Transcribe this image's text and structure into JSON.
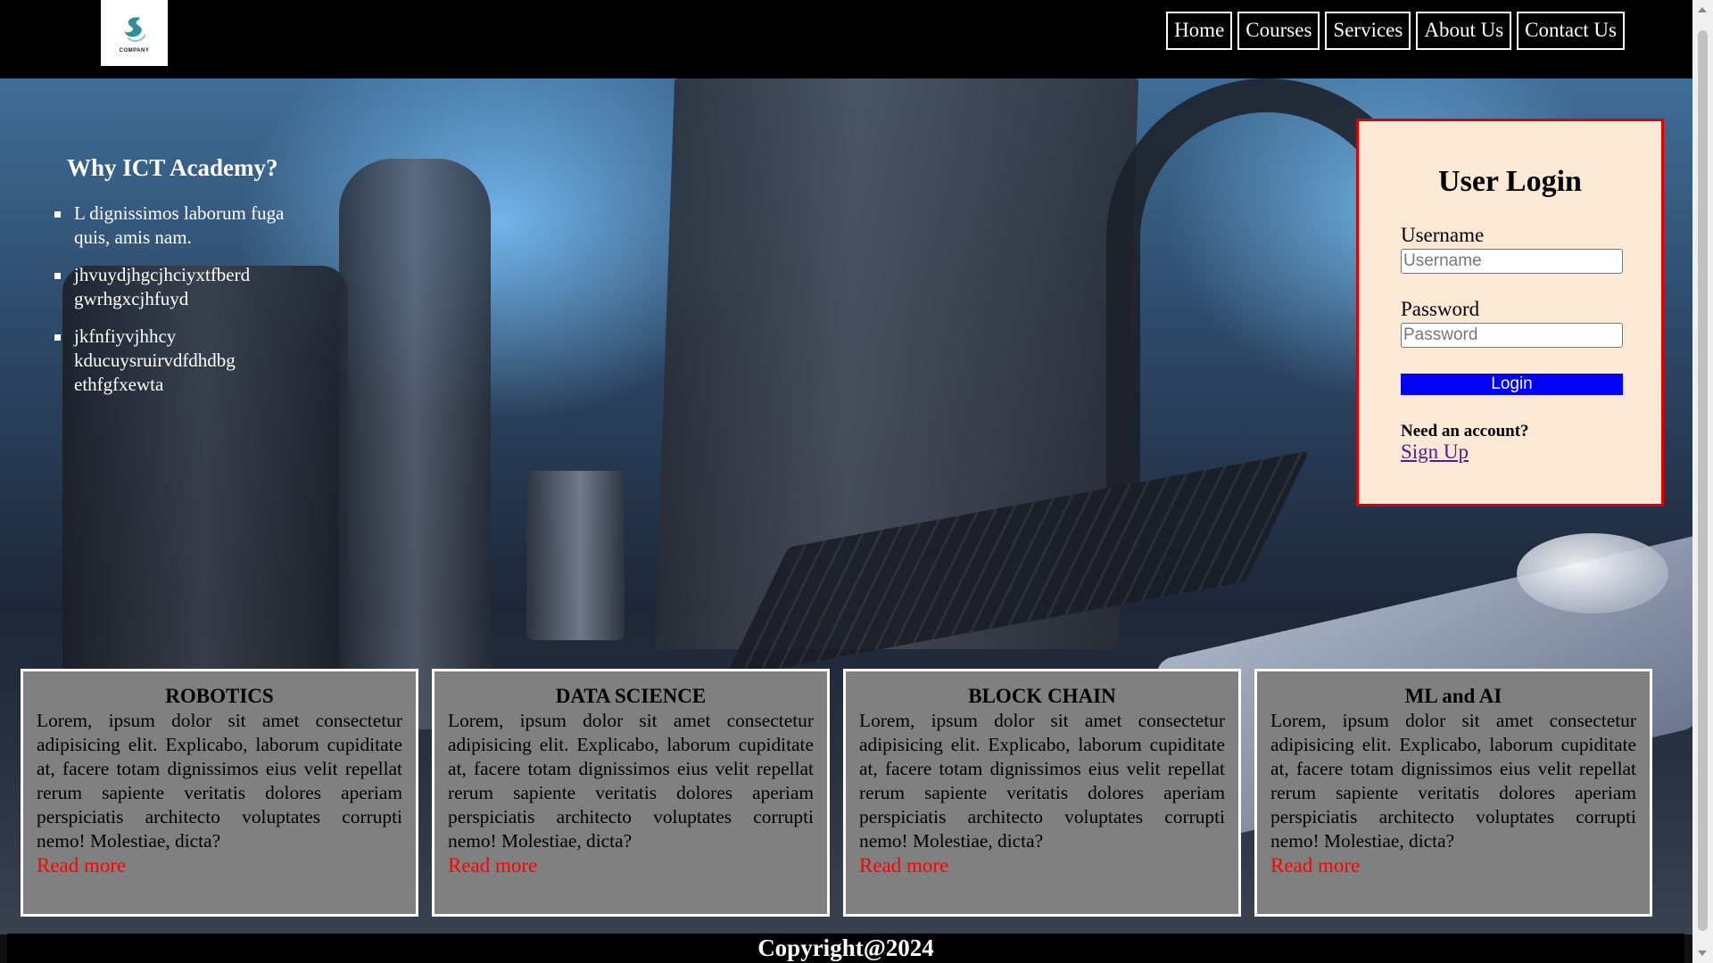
{
  "header": {
    "logo_text": "COMPANY",
    "nav": [
      "Home",
      "Courses",
      "Services",
      "About Us",
      "Contact Us"
    ]
  },
  "why": {
    "title": "Why ICT Academy?",
    "items": [
      "L dignissimos laborum fuga quis, amis nam.",
      "jhvuydjhgcjhciyxtfberd gwrhgxcjhfuyd",
      "jkfnfiyvjhhcy kducuysruirvdfdhdbg ethfgfxewta"
    ]
  },
  "login": {
    "title": "User Login",
    "username_label": "Username",
    "username_placeholder": "Username",
    "password_label": "Password",
    "password_placeholder": "Password",
    "button": "Login",
    "need_account": "Need an account?",
    "signup": "Sign Up"
  },
  "cards": [
    {
      "title": "ROBOTICS",
      "body": "Lorem, ipsum dolor sit amet consectetur adipisicing elit. Explicabo, laborum cupiditate at, facere totam dignissimos eius velit repellat rerum sapiente veritatis dolores aperiam perspiciatis architecto voluptates corrupti nemo! Molestiae, dicta?",
      "link": "Read more"
    },
    {
      "title": "DATA SCIENCE",
      "body": "Lorem, ipsum dolor sit amet consectetur adipisicing elit. Explicabo, laborum cupiditate at, facere totam dignissimos eius velit repellat rerum sapiente veritatis dolores aperiam perspiciatis architecto voluptates corrupti nemo! Molestiae, dicta?",
      "link": "Read more"
    },
    {
      "title": "BLOCK CHAIN",
      "body": "Lorem, ipsum dolor sit amet consectetur adipisicing elit. Explicabo, laborum cupiditate at, facere totam dignissimos eius velit repellat rerum sapiente veritatis dolores aperiam perspiciatis architecto voluptates corrupti nemo! Molestiae, dicta?",
      "link": "Read more"
    },
    {
      "title": "ML and AI",
      "body": "Lorem, ipsum dolor sit amet consectetur adipisicing elit. Explicabo, laborum cupiditate at, facere totam dignissimos eius velit repellat rerum sapiente veritatis dolores aperiam perspiciatis architecto voluptates corrupti nemo! Molestiae, dicta?",
      "link": "Read more"
    }
  ],
  "footer": {
    "text": "Copyright@2024"
  },
  "colors": {
    "header_bg": "#000000",
    "login_bg": "#fbe8d5",
    "login_border": "#e00000",
    "login_button": "#0000ff",
    "card_bg": "#808080",
    "read_more": "#ff0000"
  }
}
